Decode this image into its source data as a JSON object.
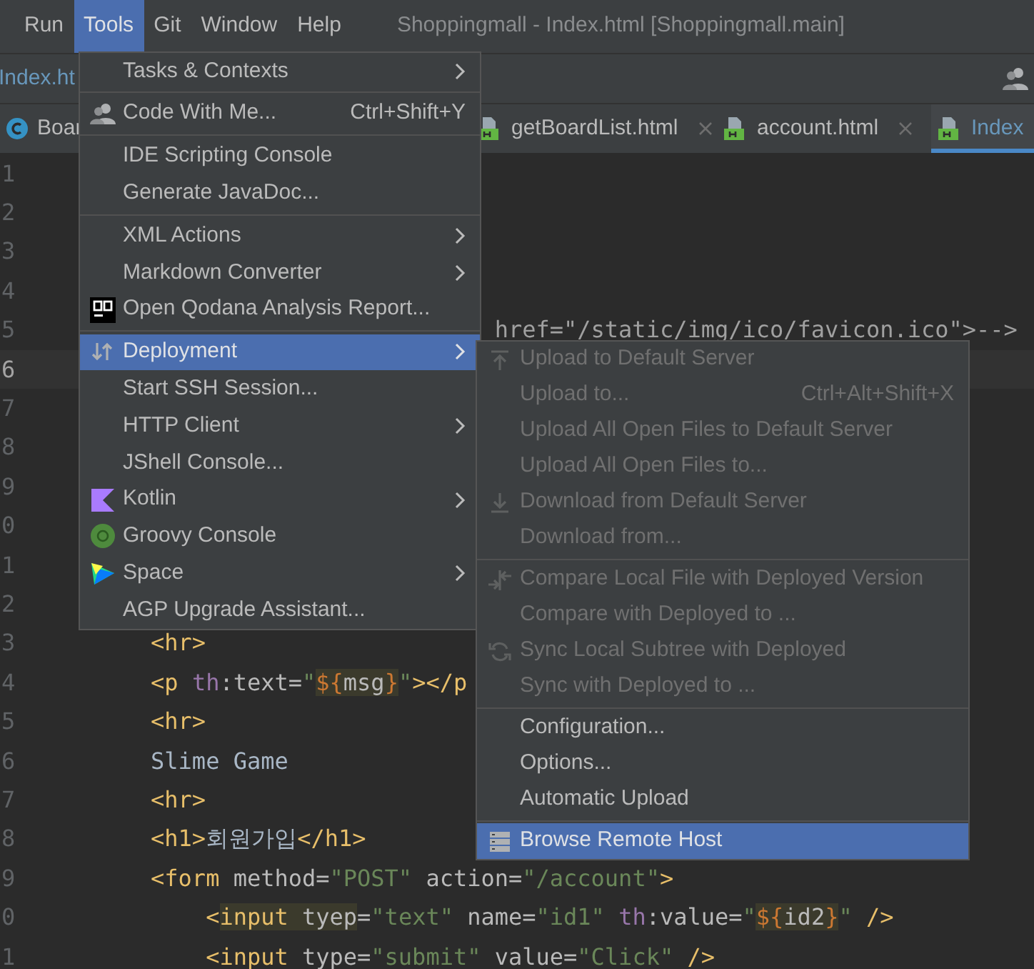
{
  "menu_bar": {
    "items": [
      {
        "label": "Run",
        "selected": false
      },
      {
        "label": "Tools",
        "selected": true
      },
      {
        "label": "Git",
        "selected": false
      },
      {
        "label": "Window",
        "selected": false
      },
      {
        "label": "Help",
        "selected": false
      }
    ],
    "title": "Shoppingmall - Index.html [Shoppingmall.main]"
  },
  "breadcrumb": "Index.ht",
  "tabs": [
    {
      "label": "Boar",
      "selected": false,
      "kind": "class"
    },
    {
      "label": "getBoardList.html",
      "selected": false,
      "closable": true,
      "kind": "html"
    },
    {
      "label": "account.html",
      "selected": false,
      "closable": true,
      "kind": "html"
    },
    {
      "label": "Index",
      "selected": true,
      "closable": false,
      "kind": "html"
    }
  ],
  "editor": {
    "lines": [
      {
        "number": "1",
        "current": false
      },
      {
        "number": "2",
        "current": false
      },
      {
        "number": "3",
        "current": false
      },
      {
        "number": "4",
        "current": false
      },
      {
        "number": "5",
        "current": false,
        "tokens": [
          {
            "text": "                             href=\"/static/img/ico/favicon.ico\">-->",
            "color": "#a0a0a0",
            "highlighted": false
          }
        ]
      },
      {
        "number": "6",
        "current": true
      },
      {
        "number": "7",
        "current": false
      },
      {
        "number": "8",
        "current": false
      },
      {
        "number": "9",
        "current": false
      },
      {
        "number": "0",
        "current": false
      },
      {
        "number": "1",
        "current": false
      },
      {
        "number": "2",
        "current": false
      },
      {
        "number": "3",
        "current": false,
        "tokens": [
          {
            "text": "    <hr>",
            "color": "#e8bf6a",
            "highlighted": false
          }
        ]
      },
      {
        "number": "4",
        "current": false,
        "tokens": [
          {
            "text": "    <p ",
            "color": "#e8bf6a",
            "highlighted": false
          },
          {
            "text": "th",
            "color": "#9876aa",
            "highlighted": false
          },
          {
            "text": ":text=",
            "color": "#bababa",
            "highlighted": false
          },
          {
            "text": "\"",
            "color": "#6a8759",
            "highlighted": false
          },
          {
            "text": "${",
            "color": "#cc7832",
            "highlighted": true
          },
          {
            "text": "msg",
            "color": "#bababa",
            "highlighted": true
          },
          {
            "text": "}",
            "color": "#cc7832",
            "highlighted": true
          },
          {
            "text": "\"",
            "color": "#6a8759",
            "highlighted": false
          },
          {
            "text": "></p",
            "color": "#e8bf6a",
            "highlighted": false
          }
        ]
      },
      {
        "number": "5",
        "current": false,
        "tokens": [
          {
            "text": "    <hr>",
            "color": "#e8bf6a",
            "highlighted": false
          }
        ]
      },
      {
        "number": "6",
        "current": false,
        "tokens": [
          {
            "text": "    Slime Game",
            "color": "#a9b7c6",
            "highlighted": false
          }
        ]
      },
      {
        "number": "7",
        "current": false,
        "tokens": [
          {
            "text": "    <hr>",
            "color": "#e8bf6a",
            "highlighted": false
          }
        ]
      },
      {
        "number": "8",
        "current": false,
        "tokens": [
          {
            "text": "    <h1>",
            "color": "#e8bf6a",
            "highlighted": false
          },
          {
            "text": "회원가입",
            "color": "#a9b7c6",
            "highlighted": false
          },
          {
            "text": "</h1>",
            "color": "#e8bf6a",
            "highlighted": false
          }
        ]
      },
      {
        "number": "9",
        "current": false,
        "tokens": [
          {
            "text": "    <form",
            "color": "#e8bf6a",
            "highlighted": false
          },
          {
            "text": " method=",
            "color": "#bababa",
            "highlighted": false
          },
          {
            "text": "\"POST\"",
            "color": "#6a8759",
            "highlighted": false
          },
          {
            "text": " action=",
            "color": "#bababa",
            "highlighted": false
          },
          {
            "text": "\"/account\"",
            "color": "#6a8759",
            "highlighted": false
          },
          {
            "text": ">",
            "color": "#e8bf6a",
            "highlighted": false
          }
        ]
      },
      {
        "number": "0",
        "current": false,
        "tokens": [
          {
            "text": "        <",
            "color": "#e8bf6a",
            "highlighted": false
          },
          {
            "text": "input ",
            "color": "#e8bf6a",
            "highlighted": true
          },
          {
            "text": "tyep",
            "color": "#bababa",
            "highlighted": true
          },
          {
            "text": "=",
            "color": "#bababa",
            "highlighted": false
          },
          {
            "text": "\"text\"",
            "color": "#6a8759",
            "highlighted": false
          },
          {
            "text": " name=",
            "color": "#bababa",
            "highlighted": false
          },
          {
            "text": "\"id1\" ",
            "color": "#6a8759",
            "highlighted": false
          },
          {
            "text": "th",
            "color": "#9876aa",
            "highlighted": false
          },
          {
            "text": ":value=",
            "color": "#bababa",
            "highlighted": false
          },
          {
            "text": "\"",
            "color": "#6a8759",
            "highlighted": false
          },
          {
            "text": "${",
            "color": "#cc7832",
            "highlighted": true
          },
          {
            "text": "id2",
            "color": "#bababa",
            "highlighted": true
          },
          {
            "text": "}",
            "color": "#cc7832",
            "highlighted": true
          },
          {
            "text": "\"",
            "color": "#6a8759",
            "highlighted": false
          },
          {
            "text": " />",
            "color": "#e8bf6a",
            "highlighted": false
          }
        ]
      },
      {
        "number": "1",
        "current": false,
        "tokens": [
          {
            "text": "        <input",
            "color": "#e8bf6a",
            "highlighted": false
          },
          {
            "text": " type=",
            "color": "#bababa",
            "highlighted": false
          },
          {
            "text": "\"submit\"",
            "color": "#6a8759",
            "highlighted": false
          },
          {
            "text": " value=",
            "color": "#bababa",
            "highlighted": false
          },
          {
            "text": "\"Click\"",
            "color": "#6a8759",
            "highlighted": false
          },
          {
            "text": " />",
            "color": "#e8bf6a",
            "highlighted": false
          }
        ]
      }
    ]
  },
  "tools_menu": {
    "items": [
      {
        "kind": "item",
        "label": "Tasks & Contexts",
        "submenu": true,
        "selected": false,
        "disabled": false
      },
      {
        "kind": "separator"
      },
      {
        "kind": "item",
        "label": "Code With Me...",
        "shortcut": "Ctrl+Shift+Y",
        "submenu": false,
        "selected": false,
        "disabled": false
      },
      {
        "kind": "separator"
      },
      {
        "kind": "item",
        "label": "IDE Scripting Console",
        "submenu": false,
        "selected": false,
        "disabled": false
      },
      {
        "kind": "item",
        "label": "Generate JavaDoc...",
        "submenu": false,
        "selected": false,
        "disabled": false
      },
      {
        "kind": "separator"
      },
      {
        "kind": "item",
        "label": "XML Actions",
        "submenu": true,
        "selected": false,
        "disabled": false
      },
      {
        "kind": "item",
        "label": "Markdown Converter",
        "submenu": true,
        "selected": false,
        "disabled": false
      },
      {
        "kind": "item",
        "label": "Open Qodana Analysis Report...",
        "submenu": false,
        "selected": false,
        "disabled": false
      },
      {
        "kind": "separator"
      },
      {
        "kind": "item",
        "label": "Deployment",
        "submenu": true,
        "selected": true,
        "disabled": false
      },
      {
        "kind": "item",
        "label": "Start SSH Session...",
        "submenu": false,
        "selected": false,
        "disabled": false
      },
      {
        "kind": "item",
        "label": "HTTP Client",
        "submenu": true,
        "selected": false,
        "disabled": false
      },
      {
        "kind": "item",
        "label": "JShell Console...",
        "submenu": false,
        "selected": false,
        "disabled": false
      },
      {
        "kind": "item",
        "label": "Kotlin",
        "submenu": true,
        "selected": false,
        "disabled": false
      },
      {
        "kind": "item",
        "label": "Groovy Console",
        "submenu": false,
        "selected": false,
        "disabled": false
      },
      {
        "kind": "item",
        "label": "Space",
        "submenu": true,
        "selected": false,
        "disabled": false
      },
      {
        "kind": "item",
        "label": "AGP Upgrade Assistant...",
        "submenu": false,
        "selected": false,
        "disabled": false
      }
    ]
  },
  "deployment_menu": {
    "items": [
      {
        "kind": "item",
        "label": "Upload to Default Server",
        "submenu": false,
        "selected": false,
        "disabled": true
      },
      {
        "kind": "item",
        "label": "Upload to...",
        "shortcut": "Ctrl+Alt+Shift+X",
        "submenu": false,
        "selected": false,
        "disabled": true
      },
      {
        "kind": "item",
        "label": "Upload All Open Files to Default Server",
        "submenu": false,
        "selected": false,
        "disabled": true
      },
      {
        "kind": "item",
        "label": "Upload All Open Files to...",
        "submenu": false,
        "selected": false,
        "disabled": true
      },
      {
        "kind": "item",
        "label": "Download from Default Server",
        "submenu": false,
        "selected": false,
        "disabled": true
      },
      {
        "kind": "item",
        "label": "Download from...",
        "submenu": false,
        "selected": false,
        "disabled": true
      },
      {
        "kind": "separator"
      },
      {
        "kind": "item",
        "label": "Compare Local File with Deployed Version",
        "submenu": false,
        "selected": false,
        "disabled": true
      },
      {
        "kind": "item",
        "label": "Compare with Deployed to ...",
        "submenu": false,
        "selected": false,
        "disabled": true
      },
      {
        "kind": "item",
        "label": "Sync Local Subtree with Deployed",
        "submenu": false,
        "selected": false,
        "disabled": true
      },
      {
        "kind": "item",
        "label": "Sync with Deployed to ...",
        "submenu": false,
        "selected": false,
        "disabled": true
      },
      {
        "kind": "separator"
      },
      {
        "kind": "item",
        "label": "Configuration...",
        "submenu": false,
        "selected": false,
        "disabled": false
      },
      {
        "kind": "item",
        "label": "Options...",
        "submenu": false,
        "selected": false,
        "disabled": false
      },
      {
        "kind": "item",
        "label": "Automatic Upload",
        "submenu": false,
        "selected": false,
        "disabled": false
      },
      {
        "kind": "separator"
      },
      {
        "kind": "item",
        "label": "Browse Remote Host",
        "submenu": false,
        "selected": true,
        "disabled": false
      }
    ]
  }
}
